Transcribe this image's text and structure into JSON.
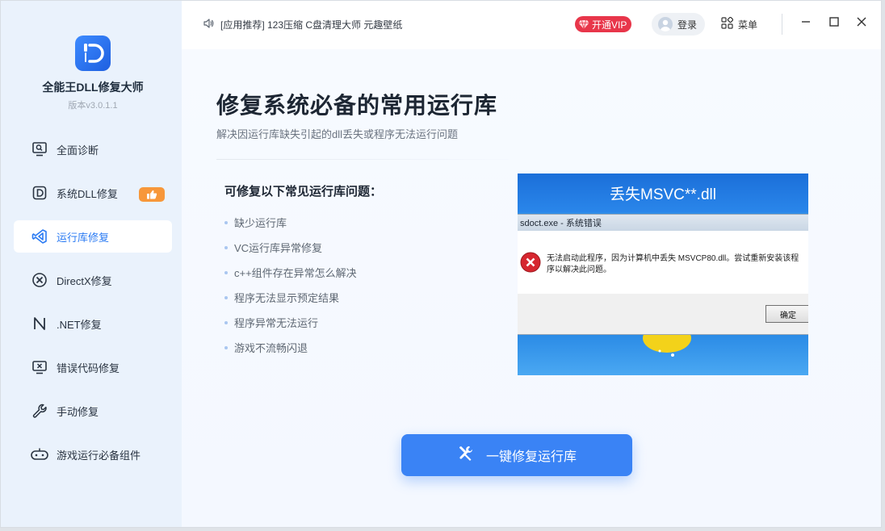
{
  "app": {
    "name": "全能王DLL修复大师",
    "version": "版本v3.0.1.1",
    "accent": "#3a83f5"
  },
  "sidebar": {
    "items": [
      {
        "label": "全面诊断",
        "icon": "monitor-search-icon"
      },
      {
        "label": "系统DLL修复",
        "icon": "dll-d-icon",
        "badge": "thumbs-up-icon"
      },
      {
        "label": "运行库修复",
        "icon": "visual-studio-icon",
        "active": true
      },
      {
        "label": "DirectX修复",
        "icon": "directx-icon"
      },
      {
        "label": ".NET修复",
        "icon": "dotnet-n-icon"
      },
      {
        "label": "错误代码修复",
        "icon": "monitor-error-icon"
      },
      {
        "label": "手动修复",
        "icon": "wrench-icon"
      },
      {
        "label": "游戏运行必备组件",
        "icon": "gamepad-icon"
      }
    ]
  },
  "topbar": {
    "marquee": "[应用推荐] 123压缩 C盘清理大师 元趣壁纸",
    "vip_label": "开通VIP",
    "login_label": "登录",
    "menu_label": "菜单"
  },
  "main": {
    "title": "修复系统必备的常用运行库",
    "subtitle": "解决因运行库缺失引起的dll丢失或程序无法运行问题",
    "issues_title": "可修复以下常见运行库问题：",
    "issues": [
      "缺少运行库",
      "VC运行库异常修复",
      "c++组件存在异常怎么解决",
      "程序无法显示预定结果",
      "程序异常无法运行",
      "游戏不流畅闪退"
    ],
    "example": {
      "banner": "丢失MSVC**.dll",
      "dialog_title": "sdoct.exe - 系统错误",
      "message": "无法启动此程序，因为计算机中丢失 MSVCP80.dll。尝试重新安装该程序以解决此问题。",
      "ok_label": "确定"
    },
    "action_label": "一键修复运行库"
  }
}
